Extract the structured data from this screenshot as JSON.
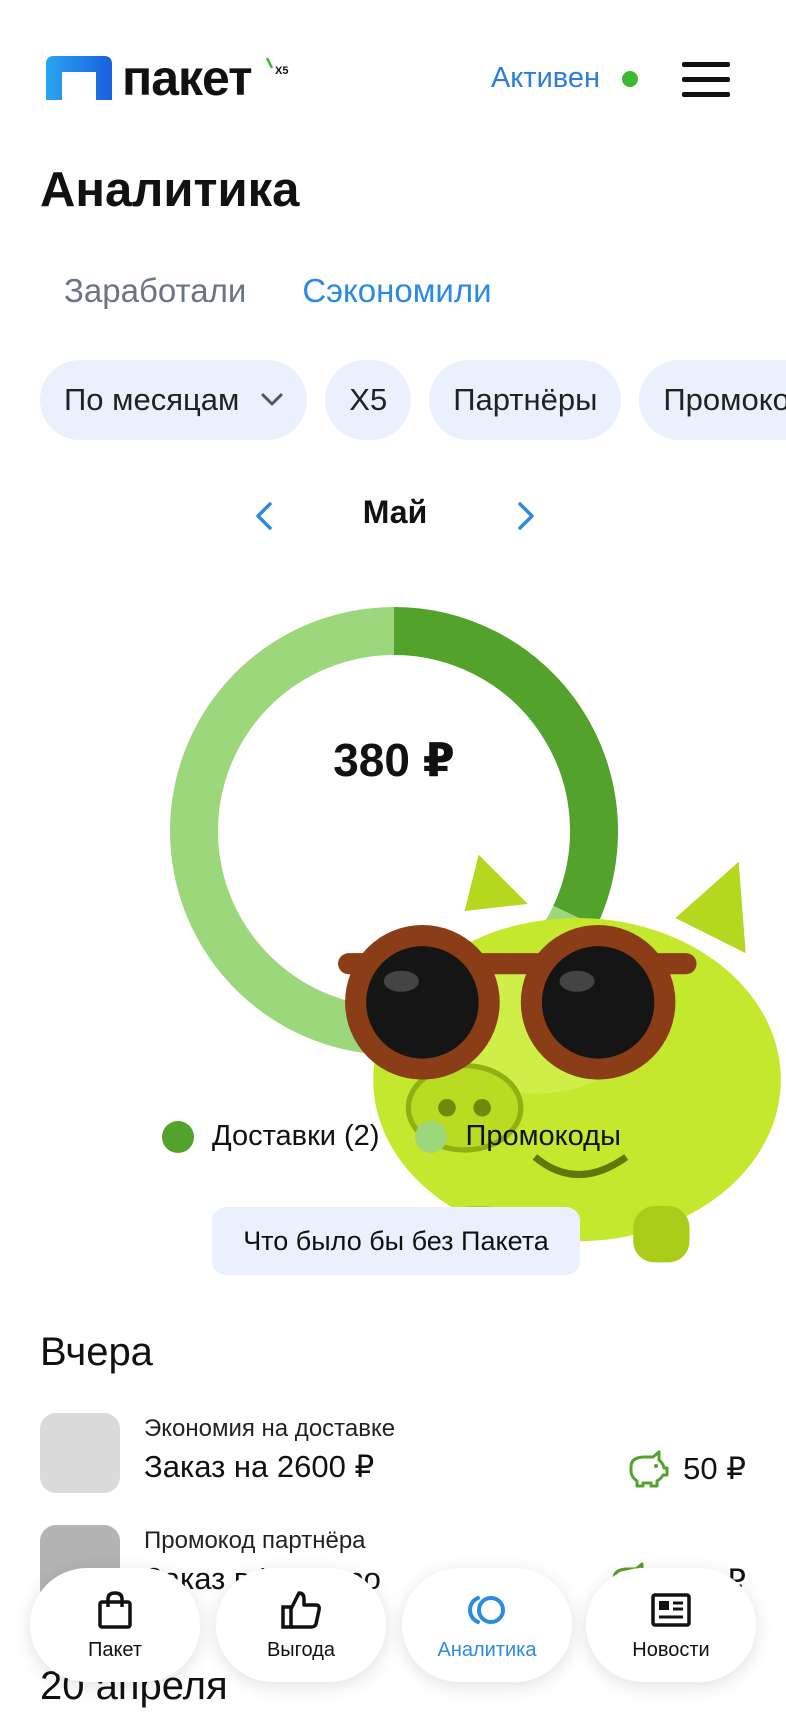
{
  "header": {
    "brand": "пакет",
    "brand_badge": "X5",
    "status_text": "Активен",
    "status_color": "#3cb832",
    "menu_icon": "hamburger-menu-icon"
  },
  "page": {
    "title": "Аналитика"
  },
  "tabs": [
    {
      "label": "Заработали",
      "active": false
    },
    {
      "label": "Сэкономили",
      "active": true
    }
  ],
  "filters": [
    {
      "label": "По месяцам",
      "dropdown": true
    },
    {
      "label": "X5"
    },
    {
      "label": "Партнёры"
    },
    {
      "label": "Промокоды"
    }
  ],
  "period": {
    "label": "Май"
  },
  "chart_data": {
    "type": "pie",
    "title": "",
    "total_label": "380 ₽",
    "series": [
      {
        "name": "Доставки (2)",
        "value": 0.32,
        "color": "#52a22b"
      },
      {
        "name": "Промокоды",
        "value": 0.68,
        "color": "#9dd77b"
      }
    ],
    "legend_position": "bottom"
  },
  "without_button": {
    "label": "Что было бы без Пакета"
  },
  "sections": [
    {
      "title": "Вчера",
      "items": [
        {
          "subtitle": "Экономия на доставке",
          "title": "Заказ на 2600 ₽",
          "amount": "50 ₽",
          "icon": "piggy-bank-icon",
          "thumb_color": "#dadada"
        },
        {
          "subtitle": "Промокод партнёра",
          "title": "Заказ в Инвитро",
          "amount": "140 ₽",
          "icon": "piggy-bank-icon",
          "thumb_color": "#b3b3b3"
        }
      ]
    },
    {
      "title": "20 апреля",
      "items": []
    }
  ],
  "bottom_nav": [
    {
      "label": "Пакет",
      "icon": "shopping-bag-icon",
      "active": false
    },
    {
      "label": "Выгода",
      "icon": "thumbs-up-icon",
      "active": false
    },
    {
      "label": "Аналитика",
      "icon": "analytics-rings-icon",
      "active": true
    },
    {
      "label": "Новости",
      "icon": "newspaper-icon",
      "active": false
    }
  ],
  "colors": {
    "accent": "#2b8ae6",
    "chip_bg": "#eaf1fc",
    "positive": "#52a22b"
  }
}
